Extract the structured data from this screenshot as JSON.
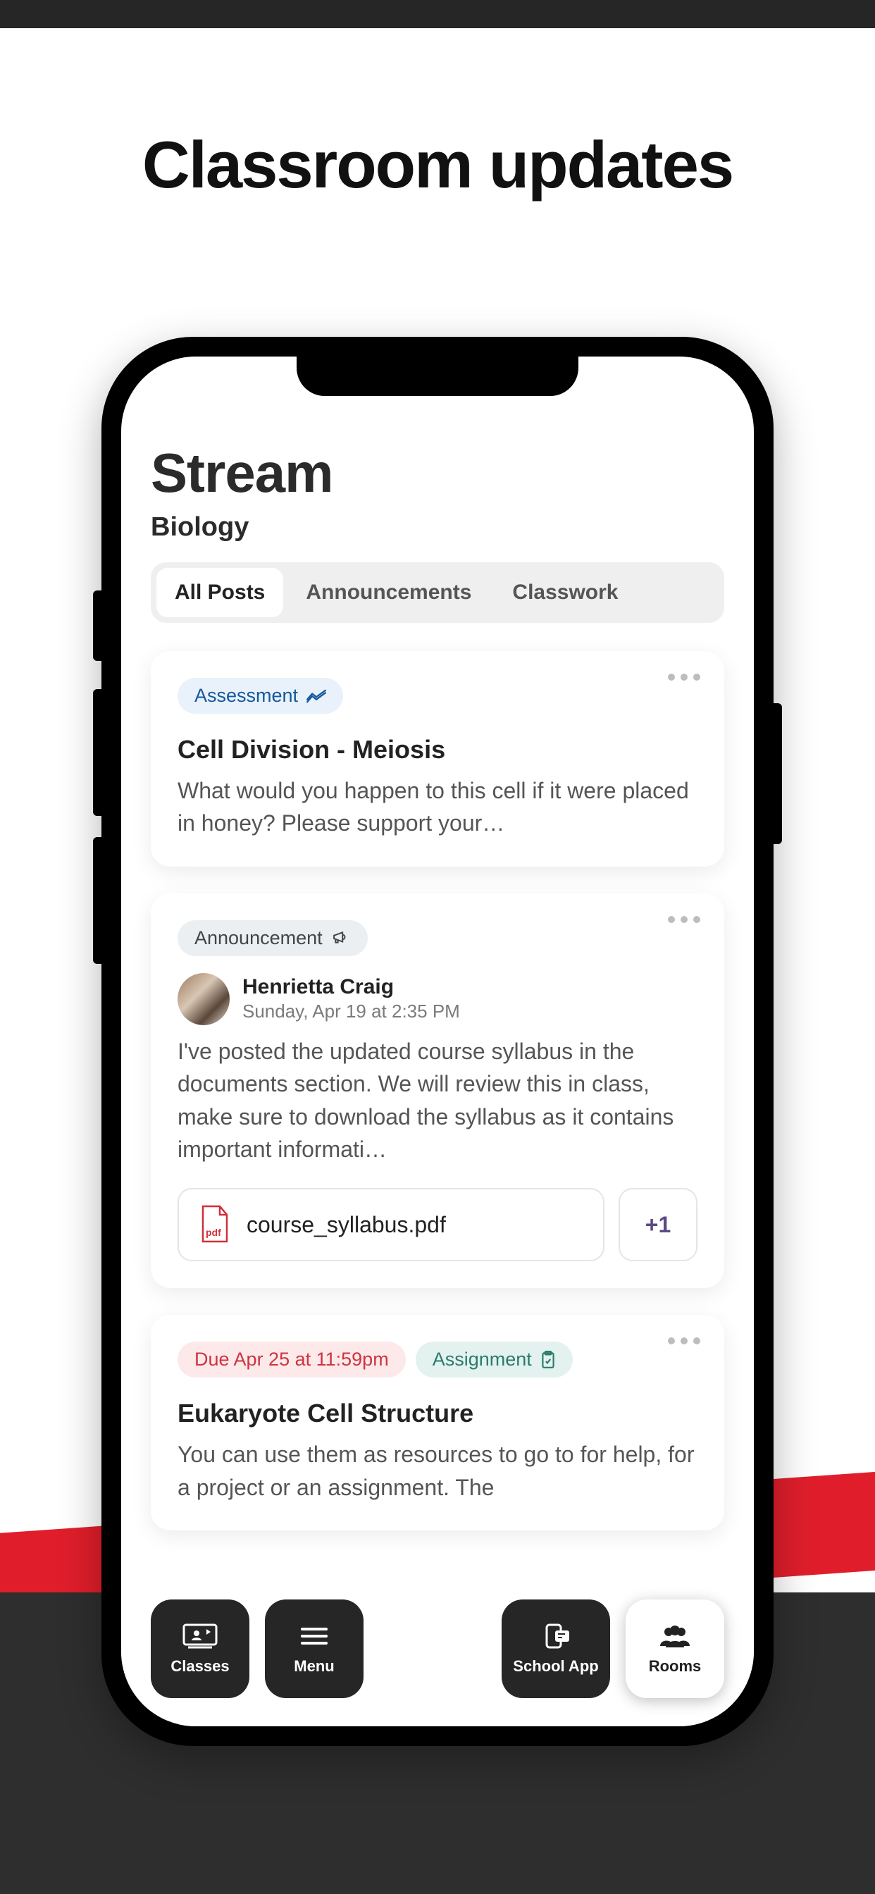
{
  "headline": "Classroom updates",
  "page": {
    "title": "Stream",
    "subtitle": "Biology",
    "tabs": [
      "All Posts",
      "Announcements",
      "Classwork"
    ],
    "active_tab_index": 0
  },
  "posts": [
    {
      "chip_label": "Assessment",
      "chip_style": "blue",
      "chip_icon": "trend-icon",
      "title": "Cell Division - Meiosis",
      "body": "What would you happen to this cell if it were placed in honey? Please support your…"
    },
    {
      "chip_label": "Announcement",
      "chip_style": "gray",
      "chip_icon": "megaphone-icon",
      "author": "Henrietta Craig",
      "timestamp": "Sunday, Apr 19 at 2:35 PM",
      "body": "I've posted the updated course syllabus in the documents section. We will review this in class, make sure to download the syllabus as it contains important informati…",
      "attachment_name": "course_syllabus.pdf",
      "attachment_more": "+1"
    },
    {
      "due_label": "Due Apr 25 at 11:59pm",
      "chip_label": "Assignment",
      "chip_style": "teal",
      "chip_icon": "clipboard-icon",
      "title": "Eukaryote Cell Structure",
      "body": "You can use them as resources to go to for help, for a project or an assignment. The"
    }
  ],
  "nav": {
    "classes": "Classes",
    "menu": "Menu",
    "school_app": "School App",
    "rooms": "Rooms"
  }
}
